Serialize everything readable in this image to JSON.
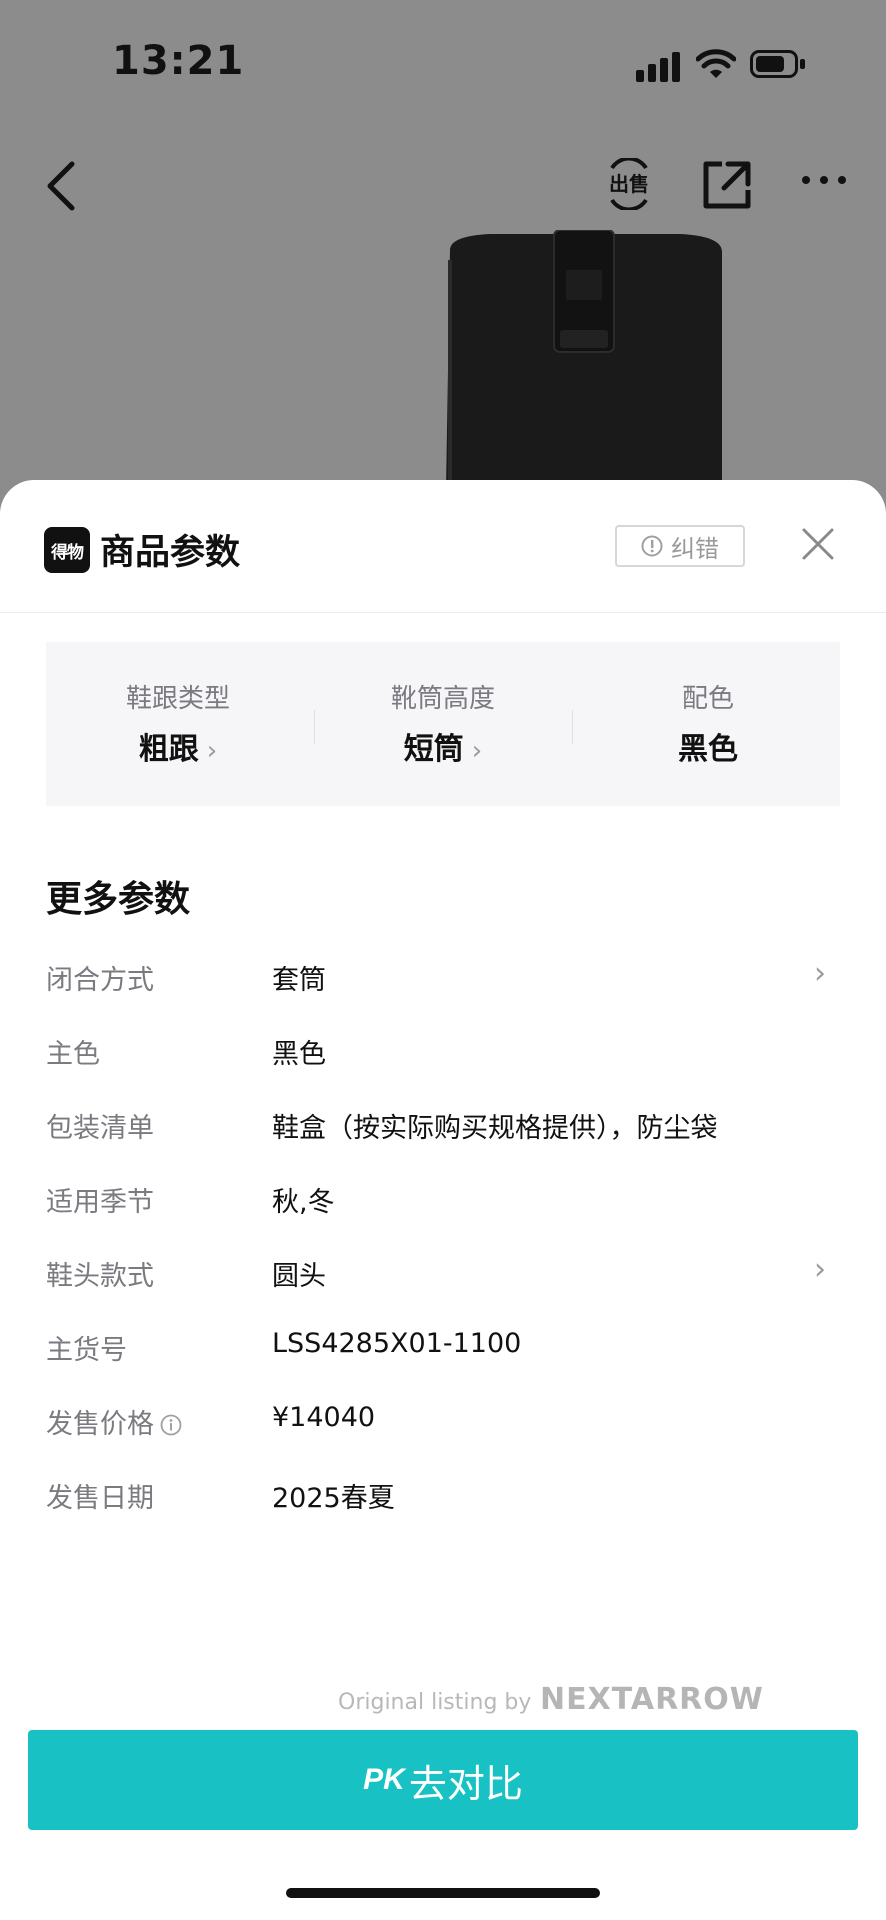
{
  "status_bar": {
    "time": "13:21"
  },
  "nav": {
    "sell_label": "出售"
  },
  "sheet": {
    "logo_text": "得物",
    "title": "商品参数",
    "report_label": "纠错"
  },
  "summary": [
    {
      "label": "鞋跟类型",
      "value": "粗跟",
      "has_chevron": true
    },
    {
      "label": "靴筒高度",
      "value": "短筒",
      "has_chevron": true
    },
    {
      "label": "配色",
      "value": "黑色",
      "has_chevron": false
    }
  ],
  "more_params": {
    "title": "更多参数",
    "rows": [
      {
        "key": "闭合方式",
        "value": "套筒",
        "has_chevron": true
      },
      {
        "key": "主色",
        "value": "黑色",
        "has_chevron": false
      },
      {
        "key": "包装清单",
        "value": "鞋盒（按实际购买规格提供），防尘袋",
        "has_chevron": false
      },
      {
        "key": "适用季节",
        "value": "秋,冬",
        "has_chevron": false
      },
      {
        "key": "鞋头款式",
        "value": "圆头",
        "has_chevron": true
      },
      {
        "key": "主货号",
        "value": "LSS4285X01-1100",
        "has_chevron": false
      },
      {
        "key": "发售价格",
        "value": "¥14040",
        "has_chevron": false,
        "has_info_icon": true
      },
      {
        "key": "发售日期",
        "value": "2025春夏",
        "has_chevron": false
      }
    ]
  },
  "watermark": {
    "prefix": "Original listing by",
    "brand": "NEXTARROW"
  },
  "footer": {
    "pk_prefix": "PK",
    "pk_label": "去对比"
  },
  "colors": {
    "accent": "#18c2c4",
    "overlay": "#8c8c8c"
  }
}
